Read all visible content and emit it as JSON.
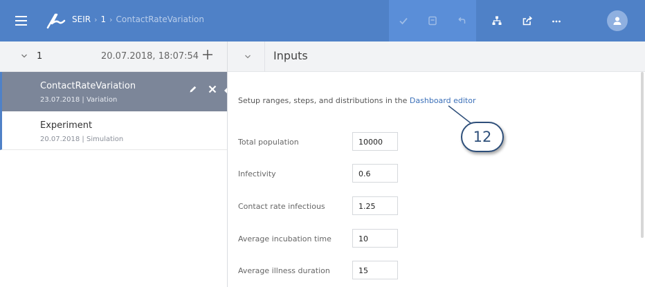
{
  "topbar": {
    "breadcrumb": {
      "model": "SEIR",
      "run": "1",
      "page": "ContactRateVariation"
    },
    "buttons": [
      "check-icon",
      "save-icon",
      "undo-icon",
      "hierarchy-icon",
      "share-icon",
      "more-icon"
    ],
    "colors": {
      "bar": "#4f81c7",
      "dim_button": "#5a8ed8"
    }
  },
  "left_panel": {
    "run_number": "1",
    "run_date": "20.07.2018, 18:07:54",
    "items": [
      {
        "title": "ContactRateVariation",
        "subtitle": "23.07.2018 | Variation",
        "active": true
      },
      {
        "title": "Experiment",
        "subtitle": "20.07.2018 | Simulation",
        "active": false
      }
    ]
  },
  "right_panel": {
    "title": "Inputs",
    "setup_text": "Setup ranges, steps, and distributions in the ",
    "setup_link": "Dashboard editor",
    "fields": [
      {
        "label": "Total population",
        "value": "10000"
      },
      {
        "label": "Infectivity",
        "value": "0.6"
      },
      {
        "label": "Contact rate infectious",
        "value": "1.25"
      },
      {
        "label": "Average incubation time",
        "value": "10"
      },
      {
        "label": "Average illness duration",
        "value": "15"
      }
    ]
  },
  "annotation": {
    "number": "12"
  }
}
